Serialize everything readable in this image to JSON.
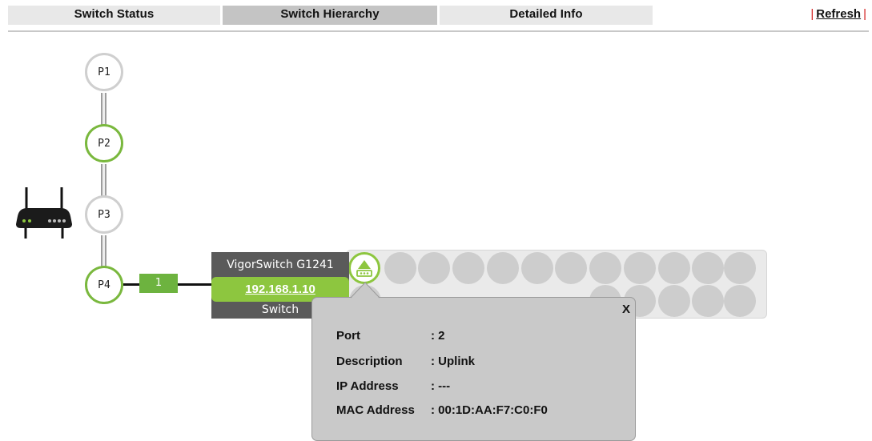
{
  "tabs": [
    {
      "label": "Switch Status",
      "active": false
    },
    {
      "label": "Switch Hierarchy",
      "active": true
    },
    {
      "label": "Detailed Info",
      "active": false
    }
  ],
  "refresh_label": "Refresh",
  "router_ports": [
    "P1",
    "P2",
    "P3",
    "P4"
  ],
  "link": {
    "port_label": "1"
  },
  "switch": {
    "model": "VigorSwitch G1241",
    "ip": "192.168.1.10",
    "type": "Switch"
  },
  "popup": {
    "close_label": "X",
    "rows": [
      {
        "key": "Port",
        "value": ": 2"
      },
      {
        "key": "Description",
        "value": ": Uplink"
      },
      {
        "key": "IP Address",
        "value": ": ---"
      },
      {
        "key": "MAC Address",
        "value": ": 00:1D:AA:F7:C0:F0"
      }
    ]
  },
  "colors": {
    "accent_green": "#8dc63f",
    "active_tab": "#c4c4c4",
    "separator_red": "#d21c1c"
  }
}
